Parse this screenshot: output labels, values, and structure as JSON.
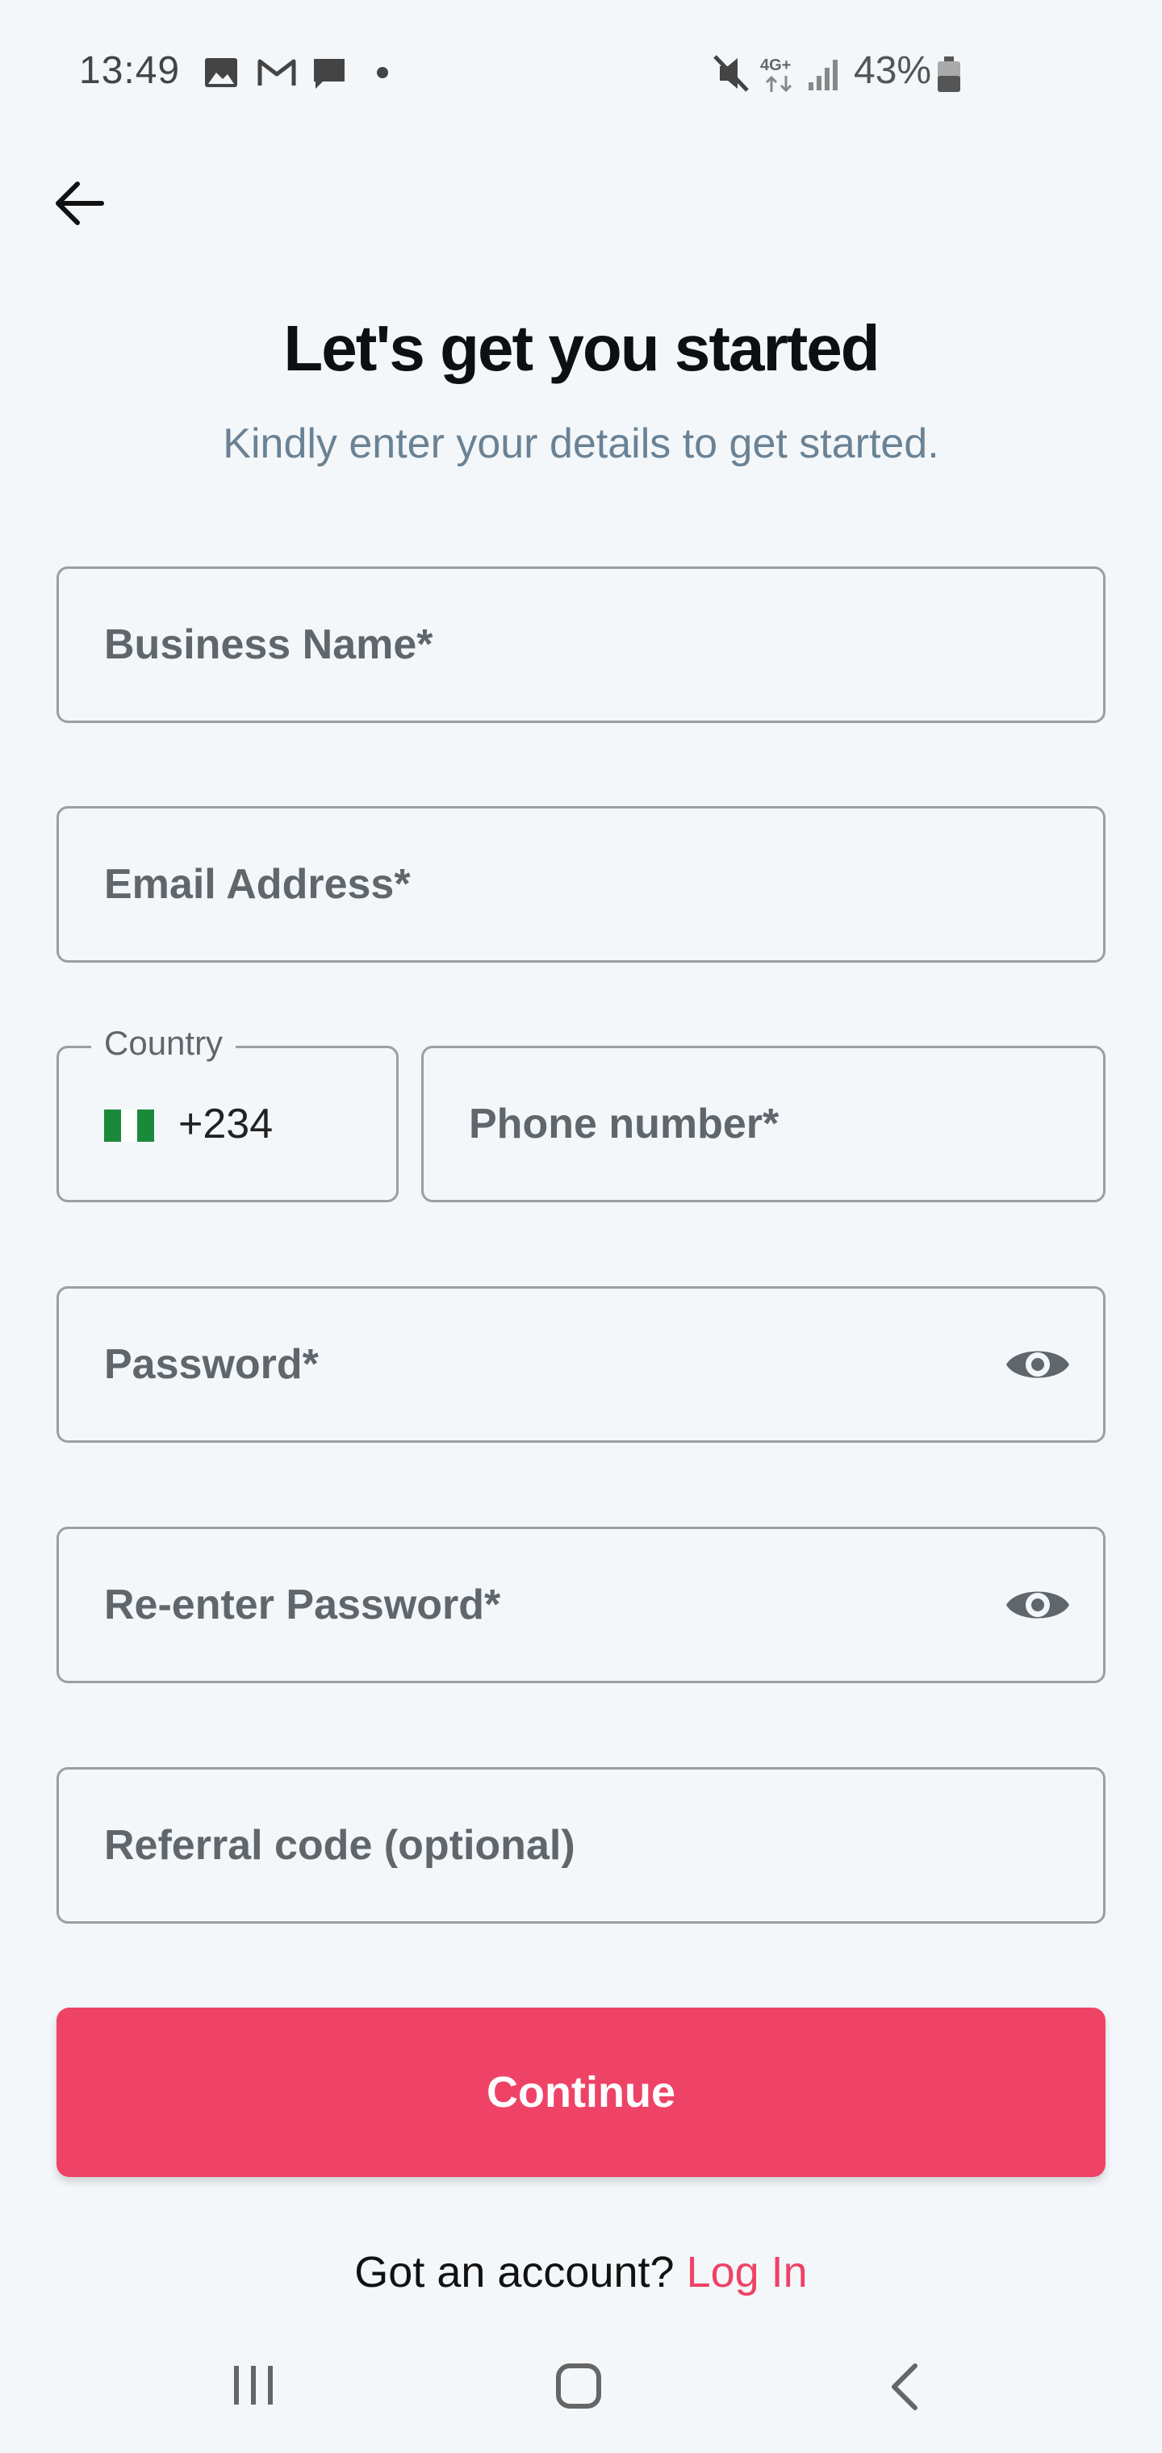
{
  "status_bar": {
    "time": "13:49",
    "battery": "43%",
    "network": "4G+",
    "icons": [
      "image-icon",
      "gmail-icon",
      "message-icon",
      "dot-icon",
      "mute-icon",
      "signal-icon",
      "battery-icon"
    ]
  },
  "header": {
    "back_icon": "arrow-left-icon"
  },
  "title": "Let's get you started",
  "subtitle": "Kindly enter your details to get started.",
  "fields": {
    "business_name": "Business Name*",
    "email": "Email Address*",
    "country_label": "Country",
    "country_code": "+234",
    "phone": "Phone number*",
    "password": "Password*",
    "reenter_password": "Re-enter Password*",
    "referral": "Referral code (optional)"
  },
  "continue_label": "Continue",
  "footer": {
    "prompt": "Got an account?",
    "login_link": "Log In"
  },
  "nav_bar": {
    "icons": [
      "recent-apps-icon",
      "home-icon",
      "back-icon"
    ]
  },
  "colors": {
    "background": "#f3f7fa",
    "accent": "#ee4367",
    "subtitle": "#6a8294",
    "border": "#9a9fa3"
  }
}
